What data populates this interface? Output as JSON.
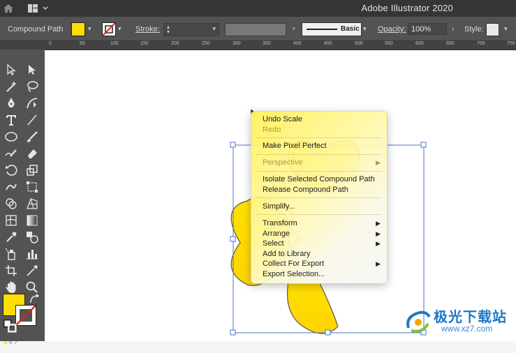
{
  "app": {
    "title": "Adobe Illustrator 2020"
  },
  "control_bar": {
    "object_type": "Compound Path",
    "stroke_label": "Stroke:",
    "brush_label": "Basic",
    "opacity_label": "Opacity:",
    "opacity_value": "100%",
    "style_label": "Style:",
    "fill_color": "#ffdd00"
  },
  "ruler": {
    "ticks": [
      "0",
      "50",
      "100",
      "150",
      "200",
      "250",
      "300",
      "350",
      "400",
      "450",
      "500",
      "550",
      "600",
      "650",
      "700",
      "750"
    ]
  },
  "context_menu": {
    "items": [
      {
        "label": "Undo Scale"
      },
      {
        "label": "Redo"
      },
      {
        "label": "Make Pixel Perfect"
      },
      {
        "label": "Perspective"
      },
      {
        "label": "Isolate Selected Compound Path"
      },
      {
        "label": "Release Compound Path"
      },
      {
        "label": "Simplify..."
      },
      {
        "label": "Transform"
      },
      {
        "label": "Arrange"
      },
      {
        "label": "Select"
      },
      {
        "label": "Add to Library"
      },
      {
        "label": "Collect For Export"
      },
      {
        "label": "Export Selection..."
      }
    ]
  },
  "watermark": {
    "title": "极光下载站",
    "url": "www.xz7.com"
  },
  "colors": {
    "accent_yellow": "#ffdd00",
    "menu_disabled": "#b19a3f",
    "selection_blue": "#4a73c8"
  }
}
